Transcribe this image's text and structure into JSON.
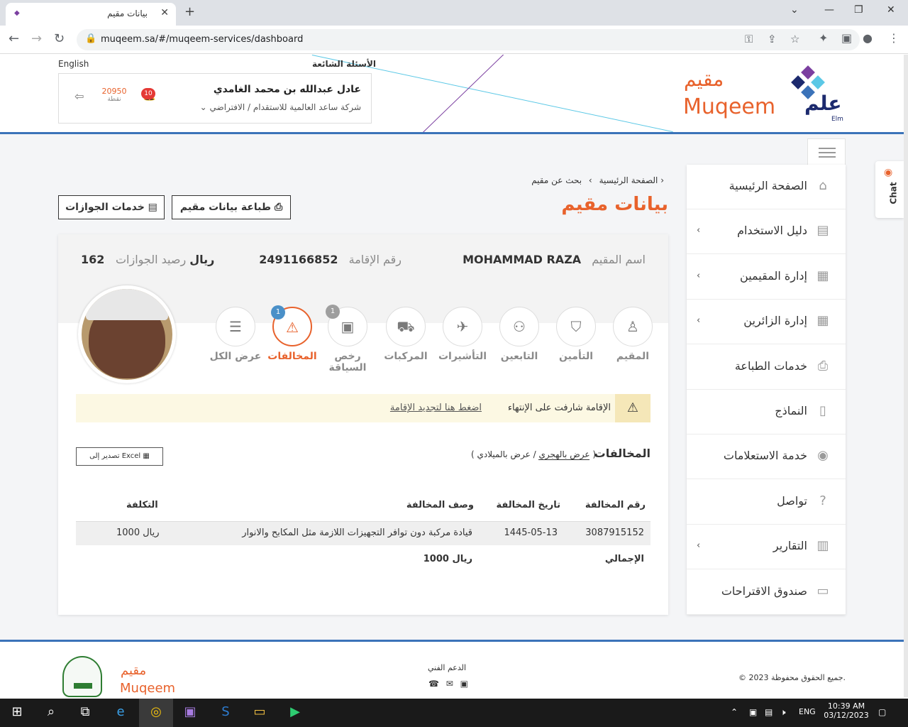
{
  "browser": {
    "tab_title": "بيانات مقيم",
    "tab_favicon": "elm",
    "url": "muqeem.sa/#/muqeem-services/dashboard"
  },
  "header": {
    "lang_label": "English",
    "faq_label": "الأسئلة الشائعة",
    "user_name": "عادل عبدالله بن محمد الغامدي",
    "company": "شركة ساعد العالمية للاستقدام / الافتراضي",
    "points_value": "20950",
    "points_label": "نقطة",
    "notifications_count": "10",
    "brand_ar": "مقيم",
    "brand_en": "Muqeem",
    "elm_ar": "علم",
    "elm_en": "Elm"
  },
  "sidebar": {
    "items": [
      {
        "label": "الصفحة الرئيسية",
        "icon": "home-icon",
        "chevron": false
      },
      {
        "label": "دليل الاستخدام",
        "icon": "book-icon",
        "chevron": true
      },
      {
        "label": "إدارة المقيمين",
        "icon": "id-card-icon",
        "chevron": true
      },
      {
        "label": "إدارة الزائرين",
        "icon": "id-card-icon",
        "chevron": true
      },
      {
        "label": "خدمات الطباعة",
        "icon": "printer-icon",
        "chevron": false
      },
      {
        "label": "النماذج",
        "icon": "document-icon",
        "chevron": false
      },
      {
        "label": "خدمة الاستعلامات",
        "icon": "eye-icon",
        "chevron": false
      },
      {
        "label": "تواصل",
        "icon": "help-icon",
        "chevron": false
      },
      {
        "label": "التقارير",
        "icon": "chart-icon",
        "chevron": true
      },
      {
        "label": "صندوق الاقتراحات",
        "icon": "inbox-icon",
        "chevron": false
      }
    ]
  },
  "chat_label": "Chat",
  "breadcrumb": {
    "home": "الصفحة الرئيسية",
    "sep": "›",
    "search": "بحث عن مقيم",
    "sep2": "›"
  },
  "page_title": "بيانات مقيم",
  "buttons": {
    "print": "طباعة بيانات مقيم",
    "passports": "خدمات الجوازات"
  },
  "resident": {
    "name_label": "اسم المقيم",
    "name": "MOHAMMAD RAZA",
    "iqama_label": "رقم الإقامة",
    "iqama": "2491166852",
    "balance_label": "رصيد الجوازات",
    "balance": "162 ريال"
  },
  "tabs": [
    {
      "label": "المقيم",
      "icon": "user-icon",
      "badge": "",
      "active": false
    },
    {
      "label": "التأمين",
      "icon": "shield-icon",
      "badge": "",
      "active": false
    },
    {
      "label": "التابعين",
      "icon": "users-icon",
      "badge": "",
      "active": false
    },
    {
      "label": "التأشيرات",
      "icon": "plane-icon",
      "badge": "",
      "active": false
    },
    {
      "label": "المركبات",
      "icon": "car-icon",
      "badge": "",
      "active": false
    },
    {
      "label": "رخص السياقة",
      "icon": "license-icon",
      "badge": "1",
      "active": false
    },
    {
      "label": "المخالفات",
      "icon": "warning-icon",
      "badge": "1",
      "active": true
    },
    {
      "label": "عرض الكل",
      "icon": "list-icon",
      "badge": "",
      "active": false
    }
  ],
  "alert": {
    "text": "الإقامة شارفت على الإنتهاء",
    "link": "اضغط هنا لتجديد الإقامة"
  },
  "violations": {
    "title": "المخالفات",
    "date_hijri": "عرض بالهجري",
    "date_greg": "عرض بالميلادي",
    "paren_open": "(",
    "paren_close": ")",
    "slash": "/",
    "excel": "تصدير إلى Excel",
    "columns": [
      "رقم المخالفة",
      "تاريخ المخالفة",
      "وصف المخالفة",
      "التكلفة"
    ],
    "rows": [
      [
        "3087915152",
        "1445-05-13",
        "قيادة مركبة دون توافر التجهيزات اللازمة مثل المكابح والانوار",
        "1000 ريال"
      ]
    ],
    "total_label": "الإجمالي",
    "total_value": "1000 ريال"
  },
  "footer": {
    "copyright": "© جميع الحقوق محفوظة 2023.",
    "support": "الدعم الفني",
    "brand_ar": "مقيم",
    "brand_en": "Muqeem"
  },
  "taskbar": {
    "lang": "ENG",
    "time": "10:39 AM",
    "date": "03/12/2023"
  },
  "colors": {
    "accent": "#e8622c",
    "primary": "#3b73b9",
    "badge_blue": "#4a90c8"
  }
}
